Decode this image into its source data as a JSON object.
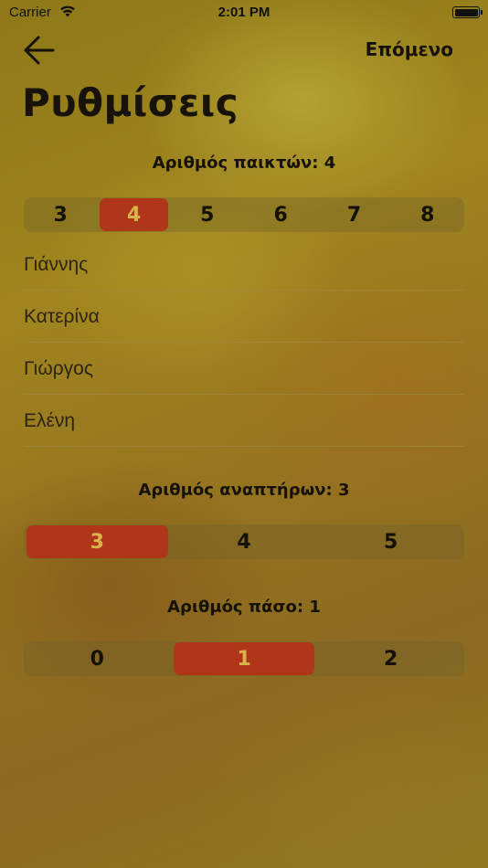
{
  "status_bar": {
    "carrier": "Carrier",
    "time": "2:01 PM"
  },
  "nav": {
    "next_label": "Επόμενο"
  },
  "title": "Ρυθμίσεις",
  "players_section": {
    "label": "Αριθμός παικτών: 4",
    "options": [
      "3",
      "4",
      "5",
      "6",
      "7",
      "8"
    ],
    "selected": "4"
  },
  "players": [
    "Γιάννης",
    "Κατερίνα",
    "Γιώργος",
    "Ελένη"
  ],
  "substitutes_section": {
    "label": "Αριθμός αναπτήρων: 3",
    "options": [
      "3",
      "4",
      "5"
    ],
    "selected": "3"
  },
  "pass_section": {
    "label": "Αριθμός πάσο: 1",
    "options": [
      "0",
      "1",
      "2"
    ],
    "selected": "1"
  },
  "colors": {
    "selected": "#b03619",
    "selected_text": "#d7b54a"
  }
}
